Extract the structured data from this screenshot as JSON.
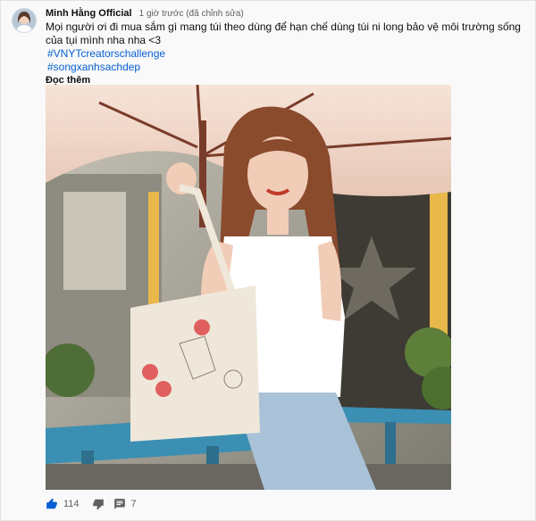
{
  "comment": {
    "author": "Minh Hằng Official",
    "time": "1 giờ trước (đã chỉnh sửa)",
    "text_lines": [
      "Mọi người ơi đi mua sắm gì mang túi theo dùng để hạn chế dùng túi ni long bảo vệ môi trường sống",
      "của tụi mình nha nha <3"
    ],
    "hashtags": [
      "#VNYTcreatorschallenge",
      "#songxanhsachdep"
    ],
    "read_more": "Đọc thêm",
    "likes": "114",
    "replies": "7"
  },
  "colors": {
    "link": "#065fd4",
    "secondary_text": "#606060",
    "umbrella": "#f1d6c9",
    "bench": "#3b8fb3"
  },
  "icons": {
    "like": "thumb-up-icon",
    "dislike": "thumb-down-icon",
    "reply": "comment-icon"
  }
}
